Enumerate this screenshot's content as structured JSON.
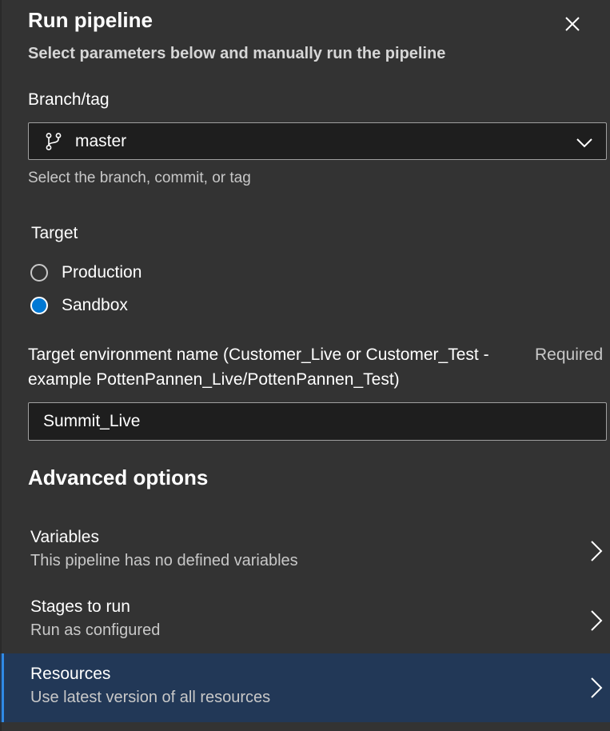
{
  "header": {
    "title": "Run pipeline",
    "subtitle": "Select parameters below and manually run the pipeline",
    "close_icon": "close-icon"
  },
  "branch": {
    "label": "Branch/tag",
    "value": "master",
    "icon": "branch-icon",
    "hint": "Select the branch, commit, or tag"
  },
  "target": {
    "label": "Target",
    "options": [
      {
        "label": "Production",
        "checked": false
      },
      {
        "label": "Sandbox",
        "checked": true
      }
    ],
    "accent_color": "#0078d4"
  },
  "environment": {
    "label_line1": "Target environment name (Customer_Live or Customer_Test -",
    "label_line2": "example PottenPannen_Live/PottenPannen_Test)",
    "required_text": "Required",
    "value": "Summit_Live"
  },
  "advanced": {
    "title": "Advanced options",
    "options": [
      {
        "title": "Variables",
        "description": "This pipeline has no defined variables",
        "selected": false
      },
      {
        "title": "Stages to run",
        "description": "Run as configured",
        "selected": false
      },
      {
        "title": "Resources",
        "description": "Use latest version of all resources",
        "selected": true
      }
    ],
    "selected_color": "#223857"
  }
}
